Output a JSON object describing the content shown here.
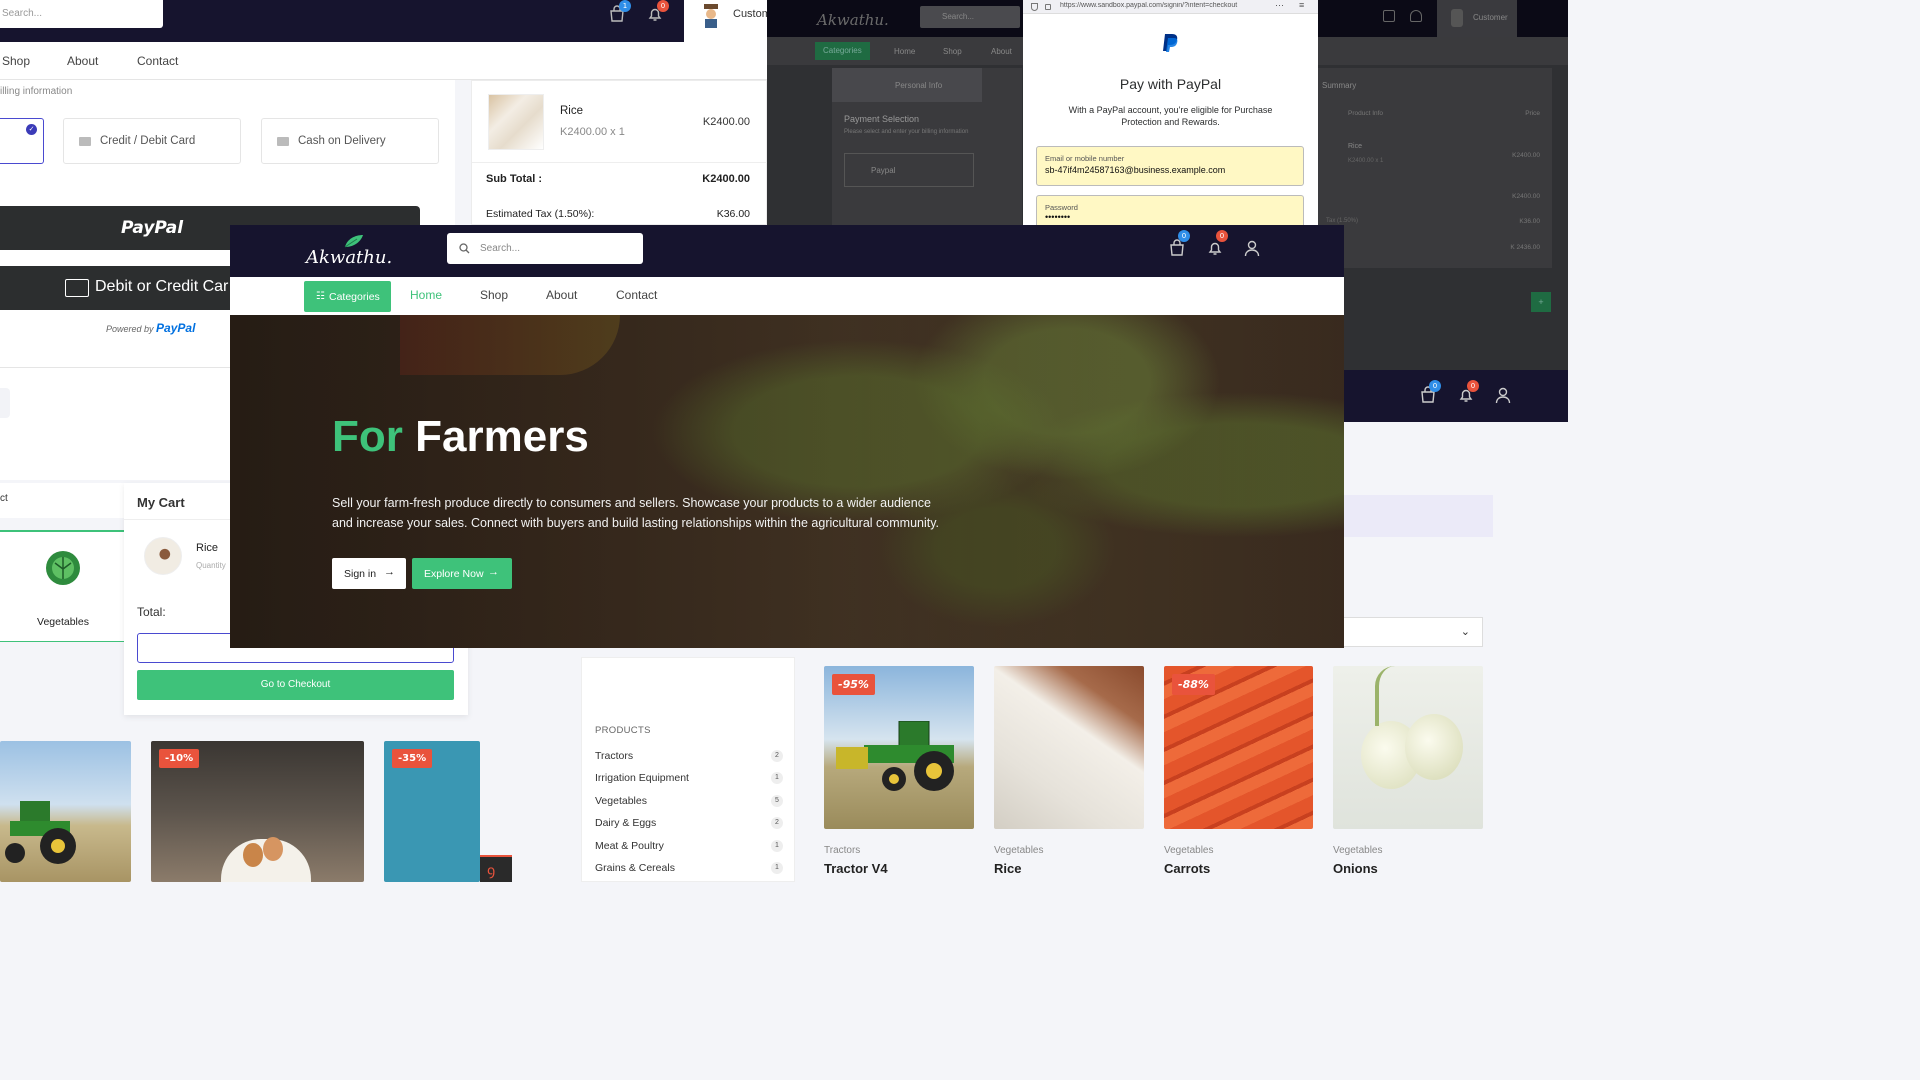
{
  "back_left": {
    "search_placeholder": "Search...",
    "customer_label": "Custom",
    "cart_count": "1",
    "notif_count": "0",
    "nav": [
      "Shop",
      "About",
      "Contact"
    ],
    "billing_text": "illing information",
    "payment_options": [
      "Credit / Debit Card",
      "Cash on Delivery"
    ],
    "paypal_btn": "PayPal",
    "debit_btn": "Debit or Credit Car",
    "powered_by": "Powered by",
    "powered_brand": "PayPal",
    "order": {
      "item_name": "Rice",
      "item_qty": "K2400.00 x 1",
      "item_price": "K2400.00",
      "subtotal_label": "Sub Total :",
      "subtotal_value": "K2400.00",
      "tax_label": "Estimated Tax (1.50%):",
      "tax_value": "K36.00"
    }
  },
  "back_right": {
    "logo": "Akwathu.",
    "search_placeholder": "Search...",
    "customer_label": "Customer",
    "nav": [
      "Categories",
      "Home",
      "Shop",
      "About"
    ],
    "personal_info": "Personal Info",
    "payment_selection": "Payment Selection",
    "payment_hint": "Please select and enter your billing information",
    "paypal_option": "Paypal",
    "summary": "Summary",
    "col_product": "Product Info",
    "col_price": "Price",
    "rice": "Rice",
    "rice_qty": "K2400.00 x 1",
    "rice_price": "K2400.00",
    "subtotal": "K2400.00",
    "tax_label": "Tax (1.50%)",
    "tax": "K36.00",
    "total": "K 2436.00"
  },
  "paypal_popup": {
    "url": "https://www.sandbox.paypal.com/signin/?intent=checkout",
    "title": "Pay with PayPal",
    "subtitle": "With a PayPal account, you're eligible for Purchase Protection and Rewards.",
    "email_label": "Email or mobile number",
    "email_value": "sb-47if4m24587163@business.example.com",
    "password_label": "Password",
    "password_value": "••••••••"
  },
  "right_strip": {
    "cart_count": "0",
    "notif_count": "0"
  },
  "cart_panel": {
    "title": "My Cart",
    "item_name": "Rice",
    "item_sub": "Quantity",
    "total_label": "Total:",
    "checkout_btn": "Go to Checkout",
    "category_label": "Vegetables",
    "left_cut_label": "ct"
  },
  "bottom_left_products": [
    {
      "discount": ""
    },
    {
      "discount": "-10%"
    },
    {
      "discount": "-35%"
    }
  ],
  "sidebar": {
    "heading": "PRODUCTS",
    "items": [
      {
        "name": "Tractors",
        "count": "2"
      },
      {
        "name": "Irrigation Equipment",
        "count": "1"
      },
      {
        "name": "Vegetables",
        "count": "5"
      },
      {
        "name": "Dairy & Eggs",
        "count": "2"
      },
      {
        "name": "Meat & Poultry",
        "count": "1"
      },
      {
        "name": "Grains & Cereals",
        "count": "1"
      }
    ]
  },
  "products": [
    {
      "category": "Tractors",
      "name": "Tractor V4",
      "discount": "-95%"
    },
    {
      "category": "Vegetables",
      "name": "Rice",
      "discount": ""
    },
    {
      "category": "Vegetables",
      "name": "Carrots",
      "discount": "-88%"
    },
    {
      "category": "Vegetables",
      "name": "Onions",
      "discount": ""
    }
  ],
  "front": {
    "logo": "Akwathu.",
    "search_placeholder": "Search...",
    "cart_count": "0",
    "notif_count": "0",
    "categories_btn": "Categories",
    "nav": [
      "Home",
      "Shop",
      "About",
      "Contact"
    ],
    "hero_title_accent": "For",
    "hero_title_main": "Farmers",
    "hero_text": "Sell your farm-fresh produce directly to consumers and sellers. Showcase your products to a wider audience and increase your sales. Connect with buyers and build lasting relationships within the agricultural community.",
    "signin_btn": "Sign in",
    "explore_btn": "Explore Now"
  },
  "colors": {
    "navy": "#16142e",
    "green": "#3ec27a",
    "red_badge": "#e9533c",
    "blue_badge": "#2f8ee8",
    "paypal_blue": "#003087"
  }
}
